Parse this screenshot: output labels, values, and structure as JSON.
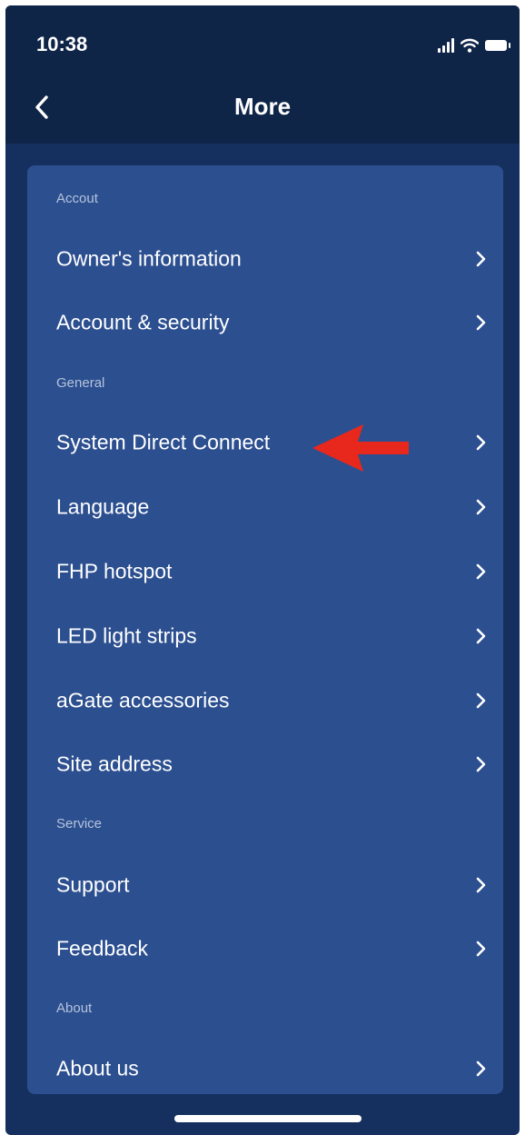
{
  "status_bar": {
    "time": "10:38"
  },
  "header": {
    "title": "More"
  },
  "sections": [
    {
      "header": "Accout",
      "items": [
        "Owner's information",
        "Account & security"
      ]
    },
    {
      "header": "General",
      "items": [
        "System Direct Connect",
        "Language",
        "FHP hotspot",
        "LED light strips",
        "aGate accessories",
        "Site address"
      ]
    },
    {
      "header": "Service",
      "items": [
        "Support",
        "Feedback"
      ]
    },
    {
      "header": "About",
      "items": [
        "About us"
      ]
    }
  ],
  "icons": {
    "back": "chevron-left-icon",
    "row": "chevron-right-icon",
    "annotation": "red-arrow-left-icon"
  },
  "colors": {
    "background": "#15305e",
    "header_bar": "#0f2548",
    "card": "#2c4f90",
    "section_header_text": "#b5c3dc",
    "item_text": "#ffffff",
    "annotation_arrow": "#e8281c"
  }
}
